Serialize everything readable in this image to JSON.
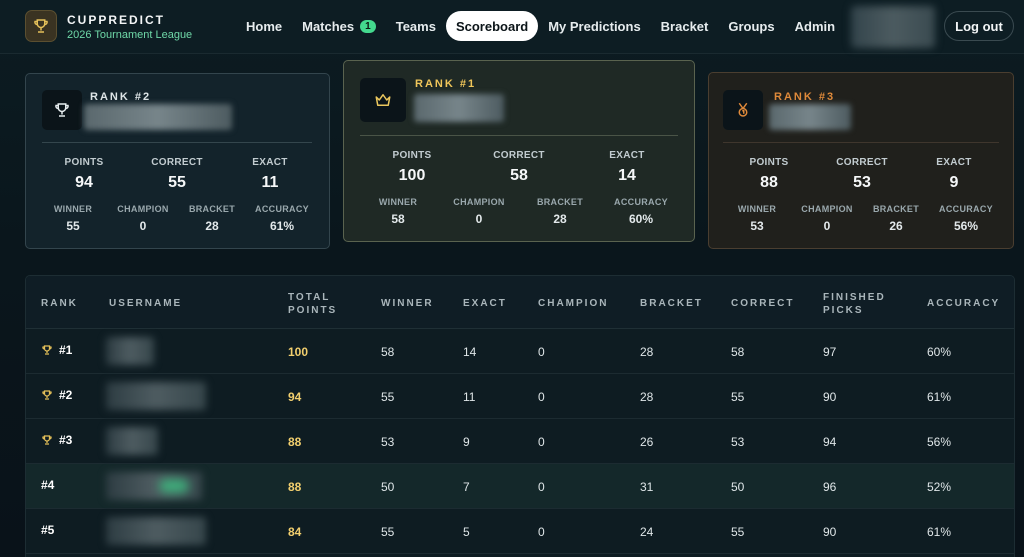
{
  "brand": {
    "name": "CUPPREDICT",
    "subtitle": "2026 Tournament League"
  },
  "nav": {
    "home": "Home",
    "matches": "Matches",
    "matches_badge": "1",
    "teams": "Teams",
    "scoreboard": "Scoreboard",
    "my_predictions": "My Predictions",
    "bracket": "Bracket",
    "groups": "Groups",
    "admin": "Admin",
    "logout": "Log out"
  },
  "podium": {
    "labels": {
      "points": "POINTS",
      "correct": "CORRECT",
      "exact": "EXACT",
      "winner": "WINNER",
      "champion": "CHAMPION",
      "bracket": "BRACKET",
      "accuracy": "ACCURACY"
    },
    "first": {
      "rank": "RANK #1",
      "points": "100",
      "correct": "58",
      "exact": "14",
      "winner": "58",
      "champion": "0",
      "bracket": "28",
      "accuracy": "60%"
    },
    "second": {
      "rank": "RANK #2",
      "points": "94",
      "correct": "55",
      "exact": "11",
      "winner": "55",
      "champion": "0",
      "bracket": "28",
      "accuracy": "61%"
    },
    "third": {
      "rank": "RANK #3",
      "points": "88",
      "correct": "53",
      "exact": "9",
      "winner": "53",
      "champion": "0",
      "bracket": "26",
      "accuracy": "56%"
    }
  },
  "table": {
    "headers": {
      "rank": "RANK",
      "username": "USERNAME",
      "total_points_1": "TOTAL",
      "total_points_2": "POINTS",
      "winner": "WINNER",
      "exact": "EXACT",
      "champion": "CHAMPION",
      "bracket": "BRACKET",
      "correct": "CORRECT",
      "finished_1": "FINISHED",
      "finished_2": "PICKS",
      "accuracy": "ACCURACY"
    },
    "rows": [
      {
        "rank": "#1",
        "points": "100",
        "winner": "58",
        "exact": "14",
        "champion": "0",
        "bracket": "28",
        "correct": "58",
        "finished": "97",
        "accuracy": "60%"
      },
      {
        "rank": "#2",
        "points": "94",
        "winner": "55",
        "exact": "11",
        "champion": "0",
        "bracket": "28",
        "correct": "55",
        "finished": "90",
        "accuracy": "61%"
      },
      {
        "rank": "#3",
        "points": "88",
        "winner": "53",
        "exact": "9",
        "champion": "0",
        "bracket": "26",
        "correct": "53",
        "finished": "94",
        "accuracy": "56%"
      },
      {
        "rank": "#4",
        "points": "88",
        "winner": "50",
        "exact": "7",
        "champion": "0",
        "bracket": "31",
        "correct": "50",
        "finished": "96",
        "accuracy": "52%"
      },
      {
        "rank": "#5",
        "points": "84",
        "winner": "55",
        "exact": "5",
        "champion": "0",
        "bracket": "24",
        "correct": "55",
        "finished": "90",
        "accuracy": "61%"
      }
    ]
  },
  "colors": {
    "accent_gold": "#f2cf6e",
    "accent_bronze": "#e08a3a",
    "badge_green": "#44d98e"
  },
  "icons": {
    "brand": "trophy-icon",
    "rank1": "crown-icon",
    "rank2": "trophy-icon",
    "rank3": "medal-icon"
  }
}
